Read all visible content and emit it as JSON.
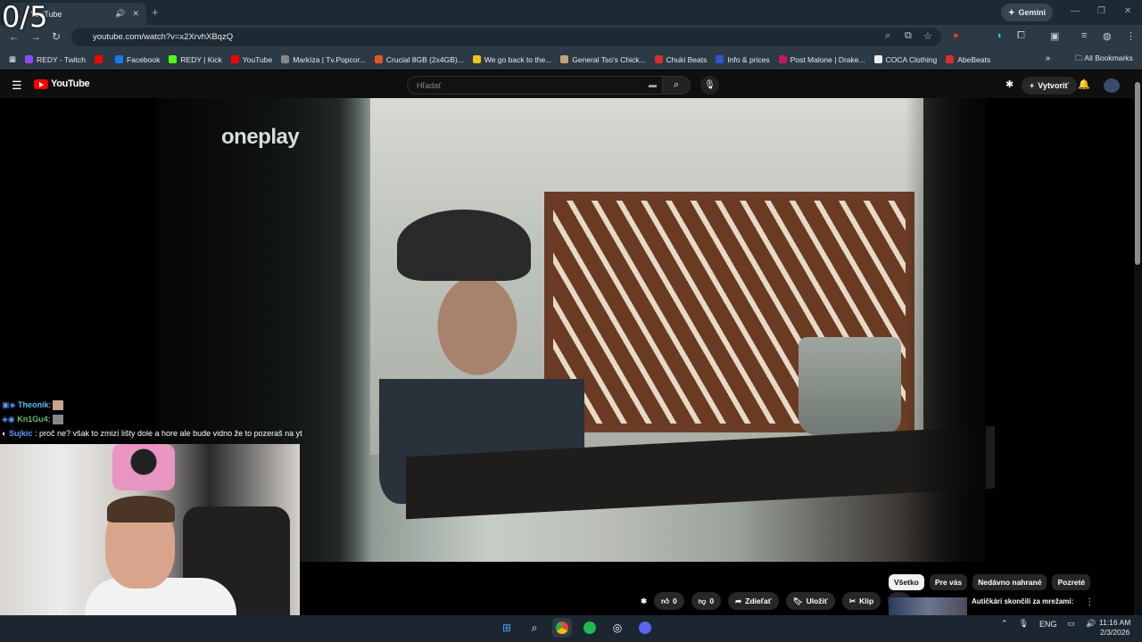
{
  "browser": {
    "tab_title": "YouTube",
    "url": "youtube.com/watch?v=x2XrvhXBqzQ",
    "gemini_label": "Gemini",
    "all_bookmarks": "All Bookmarks",
    "bookmarks": [
      {
        "label": "REDY - Twitch",
        "color": "#9146ff"
      },
      {
        "label": "",
        "color": "#ff0000"
      },
      {
        "label": "Facebook",
        "color": "#1877f2"
      },
      {
        "label": "REDY | Kick",
        "color": "#53fc18"
      },
      {
        "label": "YouTube",
        "color": "#ff0000"
      },
      {
        "label": "Markíza | Tv.Popcor...",
        "color": "#888888"
      },
      {
        "label": "Crucial 8GB (2x4GB)...",
        "color": "#e05a1e"
      },
      {
        "label": "We go back to the...",
        "color": "#f0c419"
      },
      {
        "label": "General Tso's Chick...",
        "color": "#c8a27a"
      },
      {
        "label": "Chuki Beats",
        "color": "#d63031"
      },
      {
        "label": "Info & prices",
        "color": "#2f55d4"
      },
      {
        "label": "Post Malone | Drake...",
        "color": "#c2185b"
      },
      {
        "label": "COCA Clothing",
        "color": "#eeeeee"
      },
      {
        "label": "AbeBeats",
        "color": "#d63031"
      }
    ]
  },
  "youtube": {
    "logo": "YouTube",
    "search_placeholder": "Hľadať",
    "create_label": "Vytvoriť",
    "video_watermark": "oneplay",
    "actions": {
      "like_count": "0",
      "dislike_count": "0",
      "share": "Zdieľať",
      "save": "Uložiť",
      "clip": "Klip"
    },
    "chips": [
      "Všetko",
      "Pre vás",
      "Nedávno nahrané",
      "Pozreté"
    ],
    "reco_title": "Autičkári skončili za mrežami:"
  },
  "chat": [
    {
      "user": "Theonik",
      "user_color": "#4fc3f7",
      "msg": ""
    },
    {
      "user": "Kn1Gu4",
      "user_color": "#66bb6a",
      "msg": ""
    },
    {
      "user": "Sujkic",
      "user_color": "#5c9bff",
      "msg": "proč ne? však to zmizí lišty dole a hore ale bude vidno že to pozeraš na yt"
    }
  ],
  "overlay_counter": "0/5",
  "taskbar": {
    "lang": "ENG",
    "time": "11:16 AM",
    "date": "2/3/2026"
  }
}
